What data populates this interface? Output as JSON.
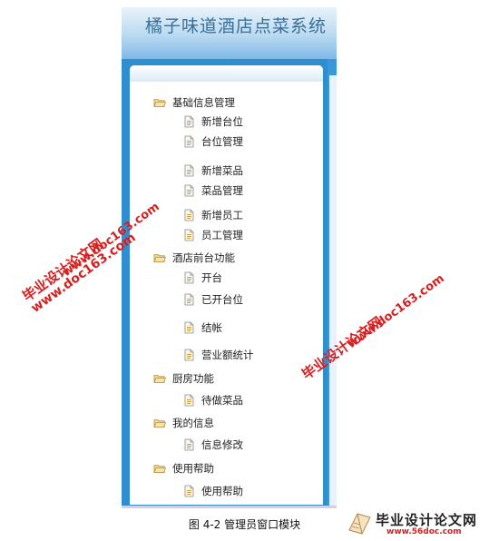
{
  "app": {
    "title": "橘子味道酒店点菜系统"
  },
  "tree": [
    {
      "kind": "group",
      "label": "基础信息管理"
    },
    {
      "kind": "leaf",
      "label": "新增台位"
    },
    {
      "kind": "leaf",
      "label": "台位管理"
    },
    {
      "kind": "leaf",
      "label": "新增菜品"
    },
    {
      "kind": "leaf",
      "label": "菜品管理"
    },
    {
      "kind": "leaf",
      "label": "新增员工"
    },
    {
      "kind": "leaf",
      "label": "员工管理"
    },
    {
      "kind": "group",
      "label": "酒店前台功能"
    },
    {
      "kind": "leaf",
      "label": "开台"
    },
    {
      "kind": "leaf",
      "label": "已开台位"
    },
    {
      "kind": "leaf",
      "label": "结帐"
    },
    {
      "kind": "leaf",
      "label": "营业额统计"
    },
    {
      "kind": "group",
      "label": "厨房功能"
    },
    {
      "kind": "leaf",
      "label": "待做菜品"
    },
    {
      "kind": "group",
      "label": "我的信息"
    },
    {
      "kind": "leaf",
      "label": "信息修改"
    },
    {
      "kind": "group",
      "label": "使用帮助"
    },
    {
      "kind": "leaf",
      "label": "使用帮助"
    }
  ],
  "caption": "图 4-2  管理员窗口模块",
  "watermark": {
    "line1": "毕业设计论文网",
    "line2": "www.doc163.com"
  },
  "logo": {
    "name": "毕业设计论文网",
    "url": "www.56doc.com"
  }
}
